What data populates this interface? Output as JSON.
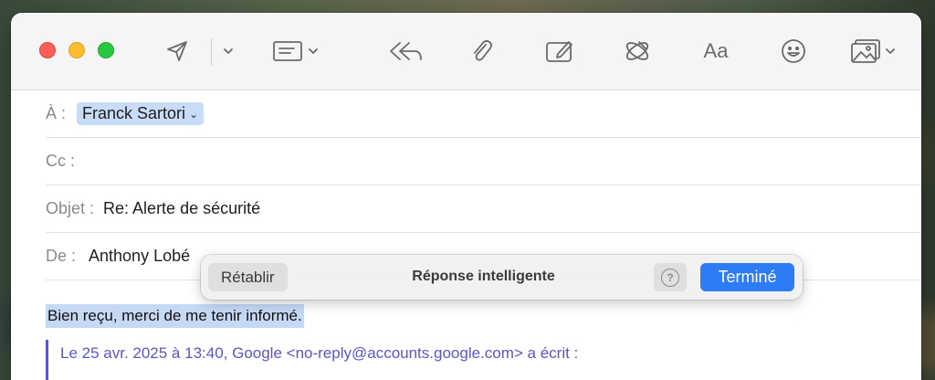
{
  "compose": {
    "to_label": "À :",
    "to_recipient": "Franck Sartori",
    "cc_label": "Cc :",
    "subject_label": "Objet :",
    "subject_value": "Re: Alerte de sécurité",
    "from_label": "De :",
    "from_value": "Anthony Lobé",
    "body_selected_text": "Bien reçu, merci de me tenir informé.",
    "quote_header": "Le 25 avr. 2025 à 13:40, Google <no-reply@accounts.google.com> a écrit :"
  },
  "toolbar": {
    "font_label": "Aa"
  },
  "smart_reply": {
    "undo_label": "Rétablir",
    "title": "Réponse intelligente",
    "help_label": "?",
    "done_label": "Terminé"
  },
  "colors": {
    "accent": "#2d7cf6",
    "selection": "#c9dcf7",
    "quote": "#5a55c9"
  }
}
